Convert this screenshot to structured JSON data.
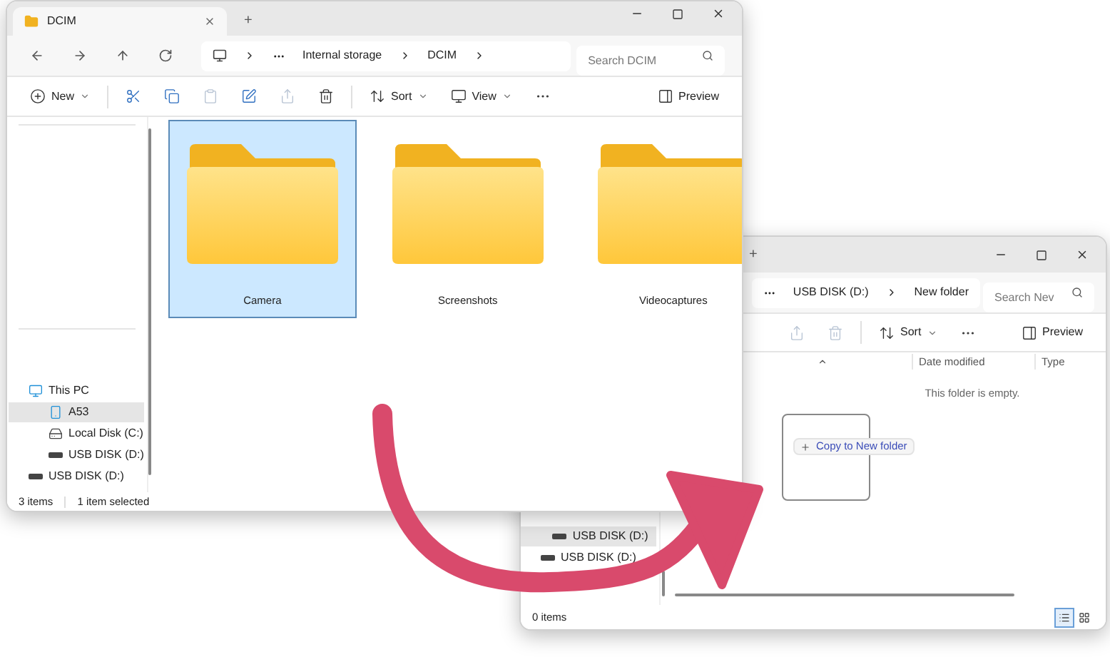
{
  "dcim_window": {
    "tab": {
      "title": "DCIM"
    },
    "new_tab": "+",
    "address": [
      "Internal storage",
      "DCIM"
    ],
    "search": {
      "placeholder": "Search DCIM"
    },
    "toolbar": [
      {
        "kind": "new",
        "label": "New",
        "disabled": false
      },
      {
        "kind": "cut",
        "disabled": false
      },
      {
        "kind": "copy",
        "disabled": false
      },
      {
        "kind": "paste",
        "disabled": true
      },
      {
        "kind": "rename",
        "disabled": false
      },
      {
        "kind": "share",
        "disabled": true
      },
      {
        "kind": "delete",
        "disabled": false
      },
      {
        "kind": "sort",
        "label": "Sort",
        "disabled": false
      },
      {
        "kind": "view",
        "label": "View",
        "disabled": false
      },
      {
        "kind": "more",
        "disabled": false
      },
      {
        "kind": "preview",
        "label": "Preview",
        "disabled": false
      }
    ],
    "nav": [
      {
        "label": "This PC",
        "kind": "pc",
        "selected": false,
        "children": [
          {
            "label": "A53",
            "kind": "phone",
            "selected": true
          },
          {
            "label": "Local Disk (C:)",
            "kind": "disk",
            "selected": false
          },
          {
            "label": "USB DISK (D:)",
            "kind": "usb",
            "selected": false
          }
        ]
      },
      {
        "label": "USB DISK (D:)",
        "kind": "usb",
        "selected": false
      }
    ],
    "files": [
      {
        "name": "Camera",
        "selected": true
      },
      {
        "name": "Screenshots",
        "selected": false
      },
      {
        "name": "Videocaptures",
        "selected": false
      }
    ],
    "status": {
      "count": "3 items",
      "selection": "1 item selected"
    }
  },
  "usb_window": {
    "new_tab": "+",
    "address": [
      "USB DISK (D:)",
      "New folder"
    ],
    "search": {
      "placeholder": "Search Nev"
    },
    "toolbar": [
      {
        "kind": "share",
        "disabled": true
      },
      {
        "kind": "delete",
        "disabled": true
      },
      {
        "kind": "sort",
        "label": "Sort",
        "disabled": false
      },
      {
        "kind": "more",
        "disabled": false
      },
      {
        "kind": "preview",
        "label": "Preview",
        "disabled": false
      }
    ],
    "columns": [
      "Date modified",
      "Type"
    ],
    "empty_message": "This folder is empty.",
    "drag_tooltip": "Copy to New folder",
    "nav": [
      {
        "label": "USB DISK (D:)",
        "kind": "usb",
        "selected": true
      },
      {
        "label": "USB DISK (D:)",
        "kind": "usb",
        "selected": false
      }
    ],
    "status": {
      "count": "0 items"
    },
    "view_buttons": [
      {
        "kind": "details",
        "selected": true
      },
      {
        "kind": "tiles",
        "selected": false
      }
    ]
  }
}
